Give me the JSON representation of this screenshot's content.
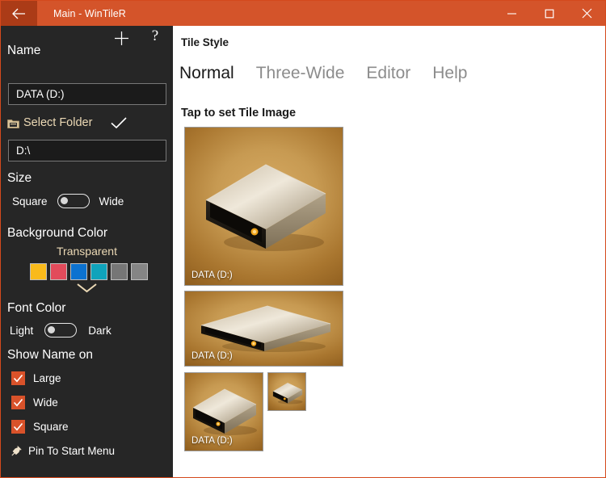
{
  "window": {
    "title": "Main - WinTileR",
    "back_icon": "back-arrow-icon",
    "minimize_label": "minimize-icon",
    "maximize_label": "maximize-icon",
    "close_label": "close-icon",
    "accent_color": "#d4542a",
    "back_button_color": "#ab3b17"
  },
  "sidebar": {
    "background_color": "#262626",
    "add_icon": "plus-icon",
    "help_icon": "question-mark-icon",
    "name_label": "Name",
    "name_value": "DATA (D:)",
    "select_folder_label": "Select Folder",
    "select_folder_icon": "folder-icon",
    "confirm_icon": "checkmark-icon",
    "path_value": "D:\\",
    "size_label": "Size",
    "size_option_left": "Square",
    "size_option_right": "Wide",
    "size_toggle_state": "off",
    "background_color_label": "Background Color",
    "transparent_label": "Transparent",
    "swatches": [
      "#f9ba1b",
      "#e24b5b",
      "#0c72d0",
      "#10a3bb",
      "#767676",
      "#858585"
    ],
    "expand_icon": "chevron-down-icon",
    "font_color_label": "Font Color",
    "font_option_left": "Light",
    "font_option_right": "Dark",
    "font_toggle_state": "off",
    "show_name_label": "Show Name on",
    "checkbox_color": "#d9522a",
    "checkboxes": [
      {
        "label": "Large",
        "checked": true
      },
      {
        "label": "Wide",
        "checked": true
      },
      {
        "label": "Square",
        "checked": true
      }
    ],
    "pin_label": "Pin To Start Menu",
    "pin_icon": "pin-icon"
  },
  "main": {
    "section_title": "Tile Style",
    "tabs": [
      {
        "label": "Normal",
        "active": true
      },
      {
        "label": "Three-Wide",
        "active": false
      },
      {
        "label": "Editor",
        "active": false
      },
      {
        "label": "Help",
        "active": false
      }
    ],
    "tiles_instruction": "Tap to set Tile Image",
    "tiles": [
      {
        "name": "large-tile",
        "caption": "DATA (D:)",
        "icon": "hard-drive-icon",
        "show_caption": true
      },
      {
        "name": "wide-tile",
        "caption": "DATA (D:)",
        "icon": "hard-drive-icon",
        "show_caption": true
      },
      {
        "name": "medium-tile",
        "caption": "DATA (D:)",
        "icon": "hard-drive-icon",
        "show_caption": true
      },
      {
        "name": "small-tile",
        "caption": "",
        "icon": "hard-drive-icon",
        "show_caption": false
      }
    ]
  }
}
